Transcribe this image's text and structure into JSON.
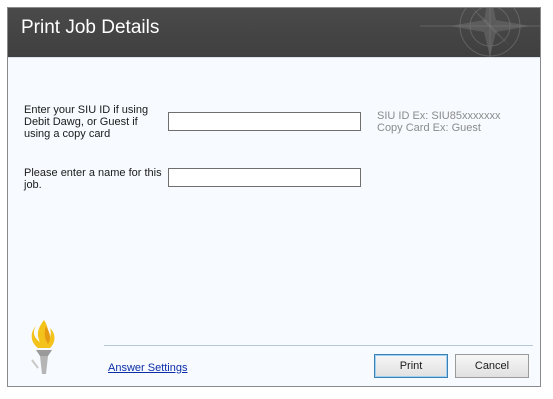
{
  "window": {
    "title": "Print Job Details"
  },
  "form": {
    "siu_id": {
      "label_lines": [
        "Enter your SIU ID if using",
        "Debit Dawg, or Guest if",
        "using a copy card"
      ],
      "value": "",
      "hint_lines": [
        "SIU ID Ex: SIU85xxxxxxx",
        "Copy Card Ex: Guest"
      ]
    },
    "job_name": {
      "label_lines": [
        "Please enter a name for this",
        "job."
      ],
      "value": ""
    }
  },
  "footer": {
    "answer_settings_link": "Answer Settings",
    "print_button": "Print",
    "cancel_button": "Cancel"
  },
  "colors": {
    "titlebar": "#434343",
    "body_background": "#f7fbff",
    "link": "#0b2ea8",
    "hint_text": "#8a8a8a",
    "logo_flame": "#f3c21b"
  },
  "icons": {
    "compass": "compass-rose-icon",
    "logo": "torch-logo-icon"
  }
}
